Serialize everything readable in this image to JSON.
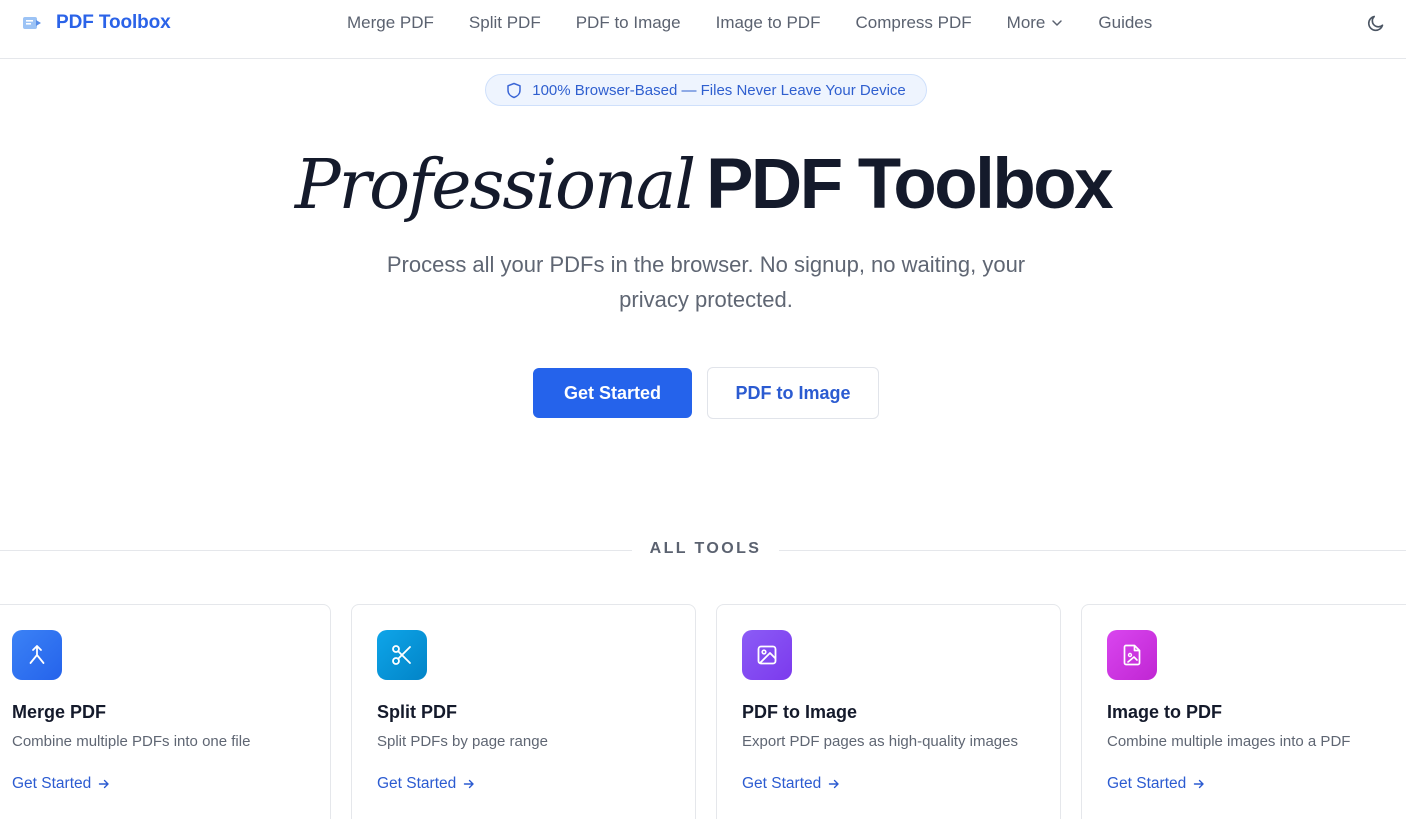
{
  "header": {
    "brand": "PDF Toolbox",
    "nav": [
      {
        "label": "Merge PDF"
      },
      {
        "label": "Split PDF"
      },
      {
        "label": "PDF to Image"
      },
      {
        "label": "Image to PDF"
      },
      {
        "label": "Compress PDF"
      },
      {
        "label": "More"
      },
      {
        "label": "Guides"
      }
    ],
    "theme_icon": "moon-icon"
  },
  "hero": {
    "badge": "100% Browser-Based — Files Never Leave Your Device",
    "title_italic": "Professional",
    "title_bold": "PDF Toolbox",
    "subtitle": "Process all your PDFs in the browser. No signup, no waiting, your privacy protected.",
    "primary_button": "Get Started",
    "secondary_button": "PDF to Image"
  },
  "tools_section": {
    "label": "ALL TOOLS",
    "cards": [
      {
        "title": "Merge PDF",
        "description": "Combine multiple PDFs into one file",
        "link": "Get Started",
        "icon": "merge-icon",
        "colors": [
          "#3b82f6",
          "#2563eb"
        ]
      },
      {
        "title": "Split PDF",
        "description": "Split PDFs by page range",
        "link": "Get Started",
        "icon": "scissors-icon",
        "colors": [
          "#0ea5e9",
          "#0284c7"
        ]
      },
      {
        "title": "PDF to Image",
        "description": "Export PDF pages as high-quality images",
        "link": "Get Started",
        "icon": "image-icon",
        "colors": [
          "#8b5cf6",
          "#7c3aed"
        ]
      },
      {
        "title": "Image to PDF",
        "description": "Combine multiple images into a PDF",
        "link": "Get Started",
        "icon": "image-file-icon",
        "colors": [
          "#d946ef",
          "#c026d3"
        ]
      }
    ]
  },
  "colors": {
    "accent": "#2563eb",
    "heading": "#141a2b",
    "muted": "#5f6673"
  }
}
